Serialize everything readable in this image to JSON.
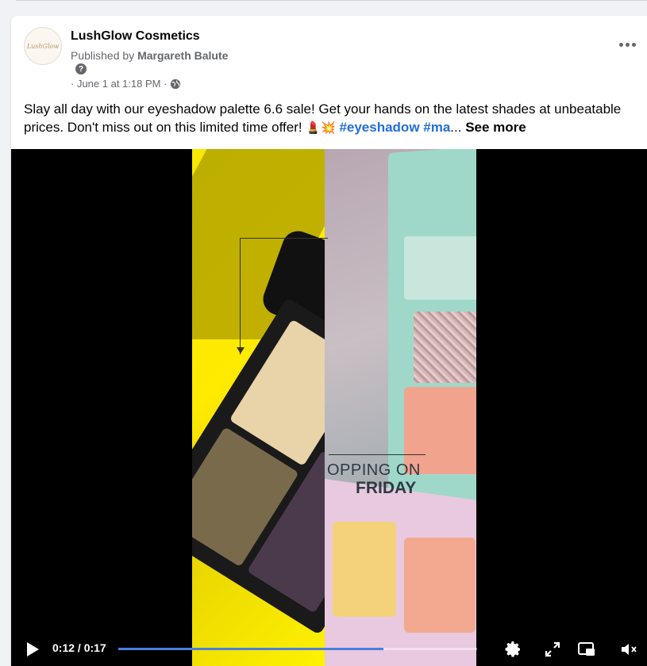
{
  "post": {
    "page_name": "LushGlow Cosmetics",
    "avatar_text": "LushGlow",
    "published_prefix": "Published by ",
    "publisher": "Margareth Balute",
    "help_glyph": "?",
    "timestamp": "· June 1 at 1:18 PM ·",
    "caption_text": "Slay all day with our eyeshadow palette 6.6 sale! Get your hands on the latest shades at unbeatable prices. Don't miss out on this limited time offer! ",
    "emoji": "💄💥",
    "hashtags": "#eyeshadow #ma",
    "ellipsis": "...",
    "see_more": "See more"
  },
  "video": {
    "overlay_line1": "OPPING ON",
    "overlay_line2": "FRIDAY",
    "current_time": "0:12",
    "duration": "0:17",
    "time_display": "0:12 / 0:17",
    "progress": 0.74
  },
  "colors": {
    "link": "#216fdb",
    "secondary_text": "#65676b",
    "progress": "#4a7fe0"
  },
  "icons": [
    "more-icon",
    "help-icon",
    "globe-icon",
    "play-icon",
    "settings-icon",
    "fullscreen-icon",
    "picture-in-picture-icon",
    "mute-icon"
  ]
}
